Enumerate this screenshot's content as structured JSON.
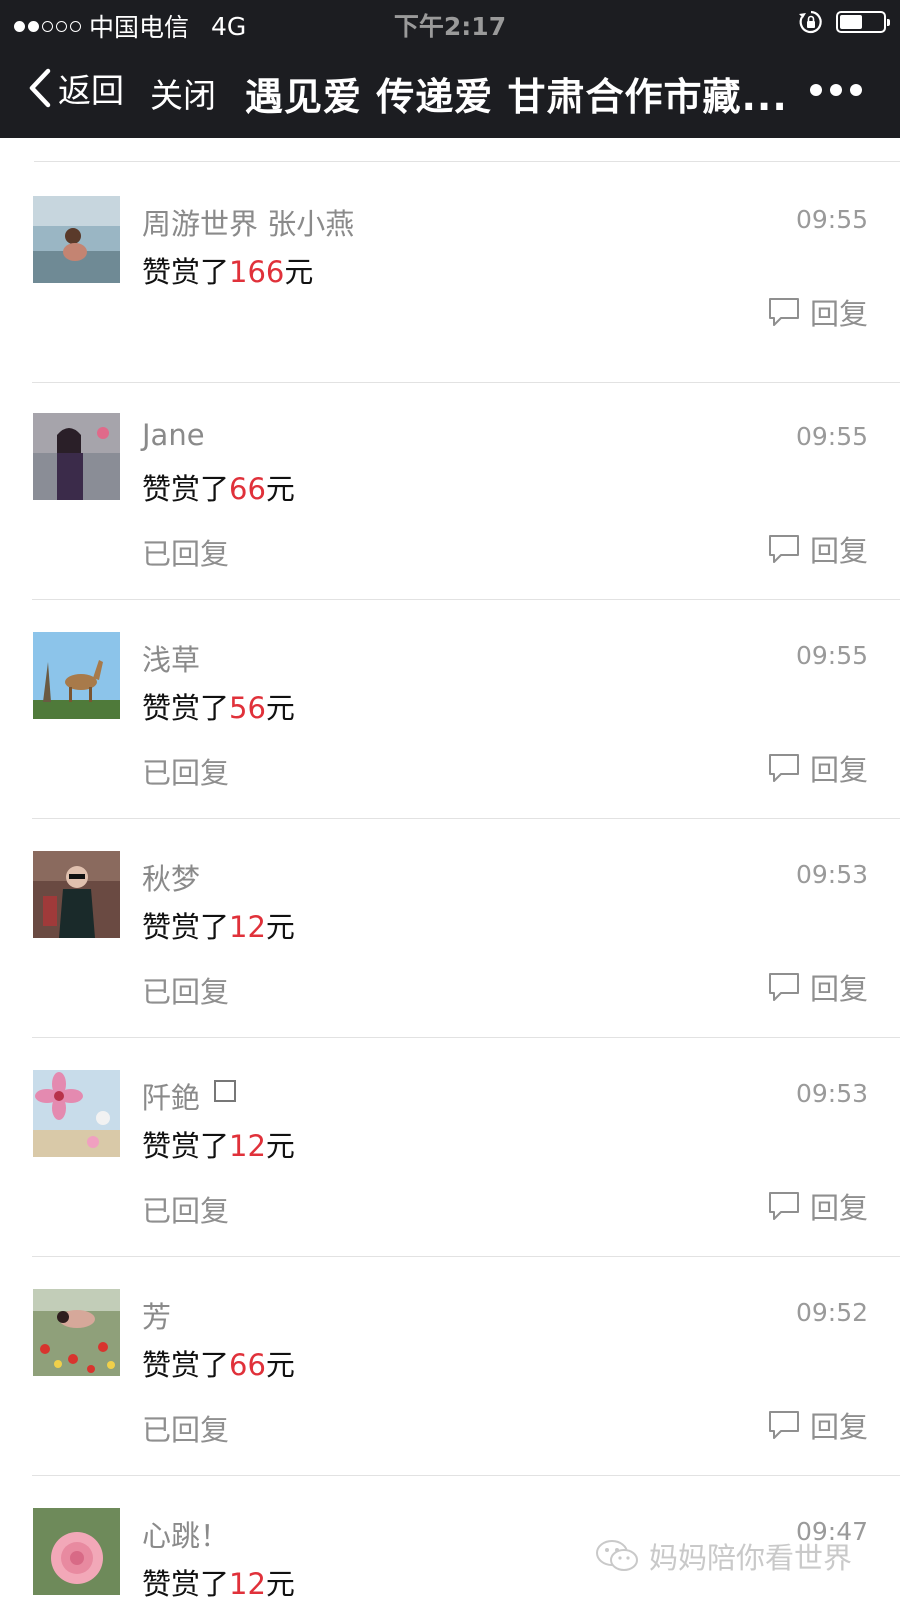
{
  "status_bar": {
    "carrier": "中国电信",
    "network": "4G",
    "time": "下午2:17"
  },
  "nav": {
    "back_label": "返回",
    "close_label": "关闭",
    "title": "遇见爱 传递爱 甘肃合作市藏..."
  },
  "items": [
    {
      "name": "周游世界 张小燕",
      "time": "09:55",
      "amount_prefix": "赞赏了",
      "amount": "166",
      "amount_unit": "元",
      "replied": "",
      "reply_label": "回复",
      "avatar_icon": "beach-child-avatar"
    },
    {
      "name": "Jane",
      "time": "09:55",
      "amount_prefix": "赞赏了",
      "amount": "66",
      "amount_unit": "元",
      "replied": "已回复",
      "reply_label": "回复",
      "avatar_icon": "woman-avatar"
    },
    {
      "name": "浅草",
      "time": "09:55",
      "amount_prefix": "赞赏了",
      "amount": "56",
      "amount_unit": "元",
      "replied": "已回复",
      "reply_label": "回复",
      "avatar_icon": "deer-avatar"
    },
    {
      "name": "秋梦",
      "time": "09:53",
      "amount_prefix": "赞赏了",
      "amount": "12",
      "amount_unit": "元",
      "replied": "已回复",
      "reply_label": "回复",
      "avatar_icon": "woman-sunglasses-avatar"
    },
    {
      "name": "阡銫",
      "time": "09:53",
      "amount_prefix": "赞赏了",
      "amount": "12",
      "amount_unit": "元",
      "replied": "已回复",
      "reply_label": "回复",
      "avatar_icon": "pink-flower-avatar"
    },
    {
      "name": "芳",
      "time": "09:52",
      "amount_prefix": "赞赏了",
      "amount": "66",
      "amount_unit": "元",
      "replied": "已回复",
      "reply_label": "回复",
      "avatar_icon": "flower-field-avatar"
    },
    {
      "name": "心跳！",
      "time": "09:47",
      "amount_prefix": "赞赏了",
      "amount": "12",
      "amount_unit": "元",
      "replied": "",
      "reply_label": "",
      "avatar_icon": "rose-avatar"
    }
  ],
  "watermark": "妈妈陪你看世界",
  "colors": {
    "topbar": "#1c1d21",
    "amount": "#e0313a",
    "muted": "#8f8f8f"
  }
}
